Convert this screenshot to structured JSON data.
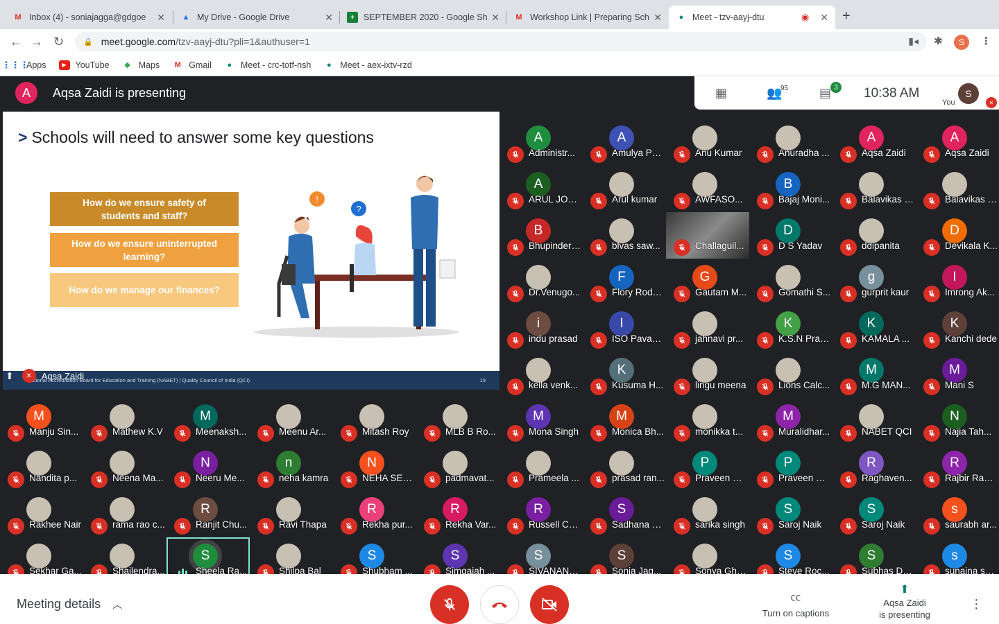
{
  "browser": {
    "tabs": [
      {
        "title": "Inbox (4) - soniajagga@gdgoe",
        "icon": "gmail-icon"
      },
      {
        "title": "My Drive - Google Drive",
        "icon": "drive-icon"
      },
      {
        "title": "SEPTEMBER 2020 - Google Sh",
        "icon": "sheets-icon"
      },
      {
        "title": "Workshop Link | Preparing Sch",
        "icon": "gmail-icon"
      },
      {
        "title": "Meet - tzv-aayj-dtu",
        "icon": "meet-icon"
      }
    ],
    "url_host": "meet.google.com",
    "url_path": "/tzv-aayj-dtu?pli=1&authuser=1",
    "profile_initial": "S",
    "bookmarks": [
      {
        "label": "Apps",
        "icon": "apps-grid-icon"
      },
      {
        "label": "YouTube",
        "icon": "youtube-icon"
      },
      {
        "label": "Maps",
        "icon": "maps-icon"
      },
      {
        "label": "Gmail",
        "icon": "gmail-icon"
      },
      {
        "label": "Meet - crc-totf-nsh",
        "icon": "meet-icon"
      },
      {
        "label": "Meet - aex-ixtv-rzd",
        "icon": "meet-icon"
      }
    ]
  },
  "meet": {
    "presenter_initial": "A",
    "presenter_text": "Aqsa Zaidi is presenting",
    "participants_count": "95",
    "chat_count": "3",
    "time": "10:38  AM",
    "you_initial": "S",
    "you_label": "You",
    "slide": {
      "heading": "Schools will need to answer some key questions",
      "questions": [
        "How do we ensure safety of students and staff?",
        "How do we ensure uninterrupted learning?",
        "How do we manage our finances?"
      ],
      "footer": "National Accreditation Board for Education and Training (NABET)  |  Quality Council of India (QCI)",
      "page": "19",
      "presenter_name": "Aqsa Zaidi"
    },
    "participants": [
      {
        "n": "Administr...",
        "i": "A",
        "c": "#1e8e3e"
      },
      {
        "n": "Amulya Pa...",
        "i": "A",
        "c": "#3f51b5"
      },
      {
        "n": "Anu Kumar",
        "i": "",
        "c": "photo"
      },
      {
        "n": "Anuradha ...",
        "i": "",
        "c": "photo"
      },
      {
        "n": "Aqsa Zaidi",
        "i": "A",
        "c": "#e0245e"
      },
      {
        "n": "Aqsa Zaidi",
        "i": "A",
        "c": "#e0245e"
      },
      {
        "n": "ARUL JOS...",
        "i": "A",
        "c": "#1b5e20"
      },
      {
        "n": "Arul kumar",
        "i": "",
        "c": "photo"
      },
      {
        "n": "AWFASO...",
        "i": "",
        "c": "photo"
      },
      {
        "n": "Bajaj Moni...",
        "i": "B",
        "c": "#1565c0"
      },
      {
        "n": "Balavikas I...",
        "i": "",
        "c": "photo"
      },
      {
        "n": "Balavikas I...",
        "i": "",
        "c": "photo"
      },
      {
        "n": "Bhupinder ...",
        "i": "B",
        "c": "#c62828"
      },
      {
        "n": "blvas saw...",
        "i": "",
        "c": "photo"
      },
      {
        "n": "Challaguil...",
        "i": "",
        "c": "video"
      },
      {
        "n": "D S Yadav",
        "i": "D",
        "c": "#00796b"
      },
      {
        "n": "ddipanita",
        "i": "",
        "c": "photo"
      },
      {
        "n": "Devikala K...",
        "i": "D",
        "c": "#ef6c00"
      },
      {
        "n": "Dr.Venugo...",
        "i": "",
        "c": "photo"
      },
      {
        "n": "Flory Rodri...",
        "i": "F",
        "c": "#1565c0"
      },
      {
        "n": "Gautam M...",
        "i": "G",
        "c": "#e64a19"
      },
      {
        "n": "Gomathi S...",
        "i": "",
        "c": "photo"
      },
      {
        "n": "gurprit kaur",
        "i": "g",
        "c": "#78909c"
      },
      {
        "n": "Imrong Ak...",
        "i": "I",
        "c": "#c2185b"
      },
      {
        "n": "indu prasad",
        "i": "i",
        "c": "#6d4c41"
      },
      {
        "n": "ISO Pavan ...",
        "i": "I",
        "c": "#3949ab"
      },
      {
        "n": "jahnavi pr...",
        "i": "",
        "c": "photo"
      },
      {
        "n": "K.S.N Pras...",
        "i": "K",
        "c": "#43a047"
      },
      {
        "n": "KAMALA ...",
        "i": "K",
        "c": "#00695c"
      },
      {
        "n": "Kanchi dede",
        "i": "K",
        "c": "#5d4037"
      },
      {
        "n": "kella venk...",
        "i": "",
        "c": "photo"
      },
      {
        "n": "Kusuma H...",
        "i": "K",
        "c": "#546e7a"
      },
      {
        "n": "lingu meena",
        "i": "",
        "c": "photo"
      },
      {
        "n": "Lions Calc...",
        "i": "",
        "c": "photo"
      },
      {
        "n": "M.G MAN...",
        "i": "M",
        "c": "#00796b"
      },
      {
        "n": "Mani S",
        "i": "M",
        "c": "#6a1b9a"
      },
      {
        "n": "Manju Sin...",
        "i": "M",
        "c": "#f4511e"
      },
      {
        "n": "Mathew K.V",
        "i": "",
        "c": "photo"
      },
      {
        "n": "Meenaksh...",
        "i": "M",
        "c": "#00695c"
      },
      {
        "n": "Meenu Ar...",
        "i": "",
        "c": "photo"
      },
      {
        "n": "Mitash Roy",
        "i": "",
        "c": "photo"
      },
      {
        "n": "MLB B Ro...",
        "i": "",
        "c": "photo"
      },
      {
        "n": "Mona Singh",
        "i": "M",
        "c": "#5e35b1"
      },
      {
        "n": "Monica Bh...",
        "i": "M",
        "c": "#d84315"
      },
      {
        "n": "monikka t...",
        "i": "",
        "c": "photo"
      },
      {
        "n": "Muralidhar...",
        "i": "M",
        "c": "#8e24aa"
      },
      {
        "n": "NABET QCI",
        "i": "",
        "c": "photo"
      },
      {
        "n": "Najia Tah...",
        "i": "N",
        "c": "#1b5e20"
      },
      {
        "n": "Nandita p...",
        "i": "",
        "c": "photo"
      },
      {
        "n": "Neena Ma...",
        "i": "",
        "c": "photo"
      },
      {
        "n": "Neeru Me...",
        "i": "N",
        "c": "#7b1fa2"
      },
      {
        "n": "neha kamra",
        "i": "n",
        "c": "#2e7d32"
      },
      {
        "n": "NEHA SEH...",
        "i": "N",
        "c": "#f4511e"
      },
      {
        "n": "padmavat...",
        "i": "",
        "c": "photo"
      },
      {
        "n": "Prameela ...",
        "i": "",
        "c": "photo"
      },
      {
        "n": "prasad ran...",
        "i": "",
        "c": "photo"
      },
      {
        "n": "Praveen M...",
        "i": "P",
        "c": "#00897b"
      },
      {
        "n": "Praveen M...",
        "i": "P",
        "c": "#00897b"
      },
      {
        "n": "Raghaven...",
        "i": "R",
        "c": "#7e57c2"
      },
      {
        "n": "Rajbir Raw...",
        "i": "R",
        "c": "#8e24aa"
      },
      {
        "n": "Rakhee Nair",
        "i": "",
        "c": "photo"
      },
      {
        "n": "rama rao c...",
        "i": "",
        "c": "photo"
      },
      {
        "n": "Ranjit Chu...",
        "i": "R",
        "c": "#6d4c41"
      },
      {
        "n": "Ravi Thapa",
        "i": "",
        "c": "photo"
      },
      {
        "n": "Rekha pur...",
        "i": "R",
        "c": "#ec407a"
      },
      {
        "n": "Rekha Var...",
        "i": "R",
        "c": "#d81b60"
      },
      {
        "n": "Russell Co...",
        "i": "R",
        "c": "#7b1fa2"
      },
      {
        "n": "Sadhana S...",
        "i": "S",
        "c": "#6a1b9a"
      },
      {
        "n": "sarika singh",
        "i": "",
        "c": "photo"
      },
      {
        "n": "Saroj Naik",
        "i": "S",
        "c": "#00897b"
      },
      {
        "n": "Saroj Naik",
        "i": "S",
        "c": "#00897b"
      },
      {
        "n": "saurabh ar...",
        "i": "s",
        "c": "#f4511e"
      },
      {
        "n": "Sekhar Ga...",
        "i": "",
        "c": "photo"
      },
      {
        "n": "Shailendra...",
        "i": "",
        "c": "photo"
      },
      {
        "n": "Sheela Ra...",
        "i": "S",
        "c": "#1e8e3e"
      },
      {
        "n": "Shilpa Bal",
        "i": "",
        "c": "photo"
      },
      {
        "n": "Shubham ...",
        "i": "S",
        "c": "#1e88e5"
      },
      {
        "n": "Simgaiah ...",
        "i": "S",
        "c": "#5e35b1"
      },
      {
        "n": "SIVANANT...",
        "i": "S",
        "c": "#78909c"
      },
      {
        "n": "Sonia Jag...",
        "i": "S",
        "c": "#5d4037"
      },
      {
        "n": "Sonya Gha...",
        "i": "",
        "c": "photo"
      },
      {
        "n": "Steve Roc...",
        "i": "S",
        "c": "#1e88e5"
      },
      {
        "n": "Subhas Dc...",
        "i": "S",
        "c": "#2e7d32"
      },
      {
        "n": "sunaina sh...",
        "i": "s",
        "c": "#1e88e5"
      }
    ]
  },
  "bottom": {
    "meeting_details": "Meeting details",
    "captions": "Turn on captions",
    "presenting_name": "Aqsa Zaidi",
    "presenting_suffix": "is presenting"
  },
  "colors": {
    "mute_red": "#d93025",
    "speaking_outline": "#7ee2d2"
  }
}
